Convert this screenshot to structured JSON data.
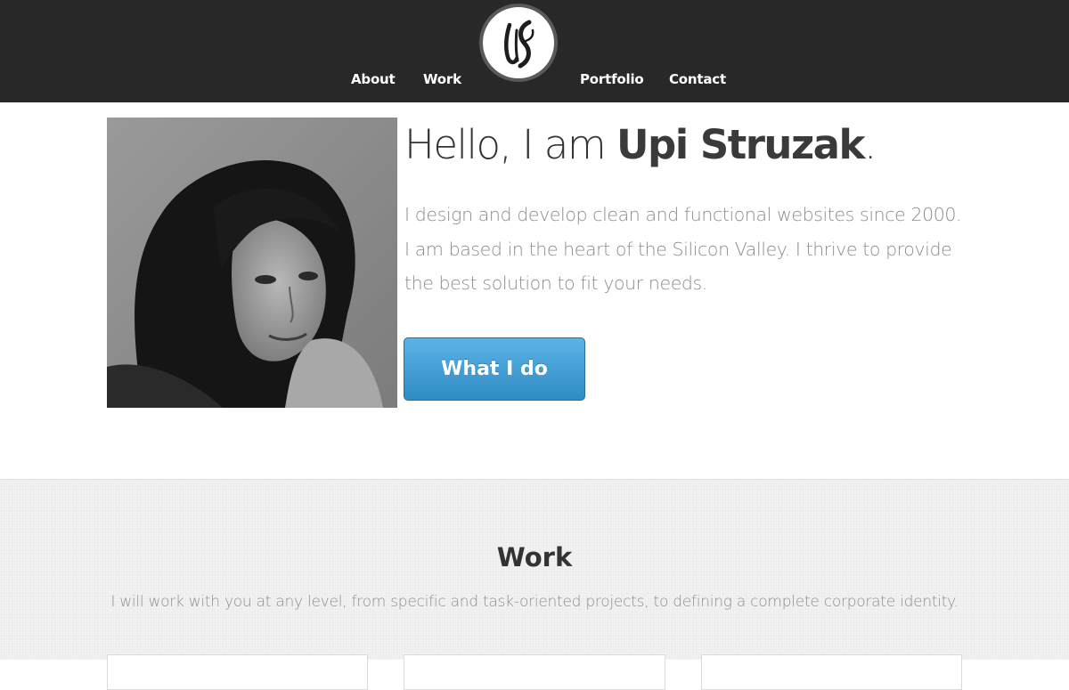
{
  "nav": {
    "items": [
      {
        "label": "About"
      },
      {
        "label": "Work"
      },
      {
        "label": "Portfolio"
      },
      {
        "label": "Contact"
      }
    ],
    "logo_text": "US"
  },
  "hero": {
    "greeting": "Hello, I am ",
    "name": "Upi Struzak",
    "period": ".",
    "description_lines": [
      "I design and develop clean and functional websites since 2000.",
      "I am based in the heart of the Silicon Valley. I thrive to provide",
      "the best solution to fit your needs."
    ],
    "cta_label": "What I do"
  },
  "work": {
    "title": "Work",
    "description": "I will work with you at any level, from specific and task-oriented projects, to defining a complete corporate identity."
  },
  "colors": {
    "header_bg": "#282828",
    "cta_blue": "#3a98d0",
    "heading": "#333333",
    "body_text": "#8c8c8c",
    "section_bg": "#f2f2f2"
  }
}
